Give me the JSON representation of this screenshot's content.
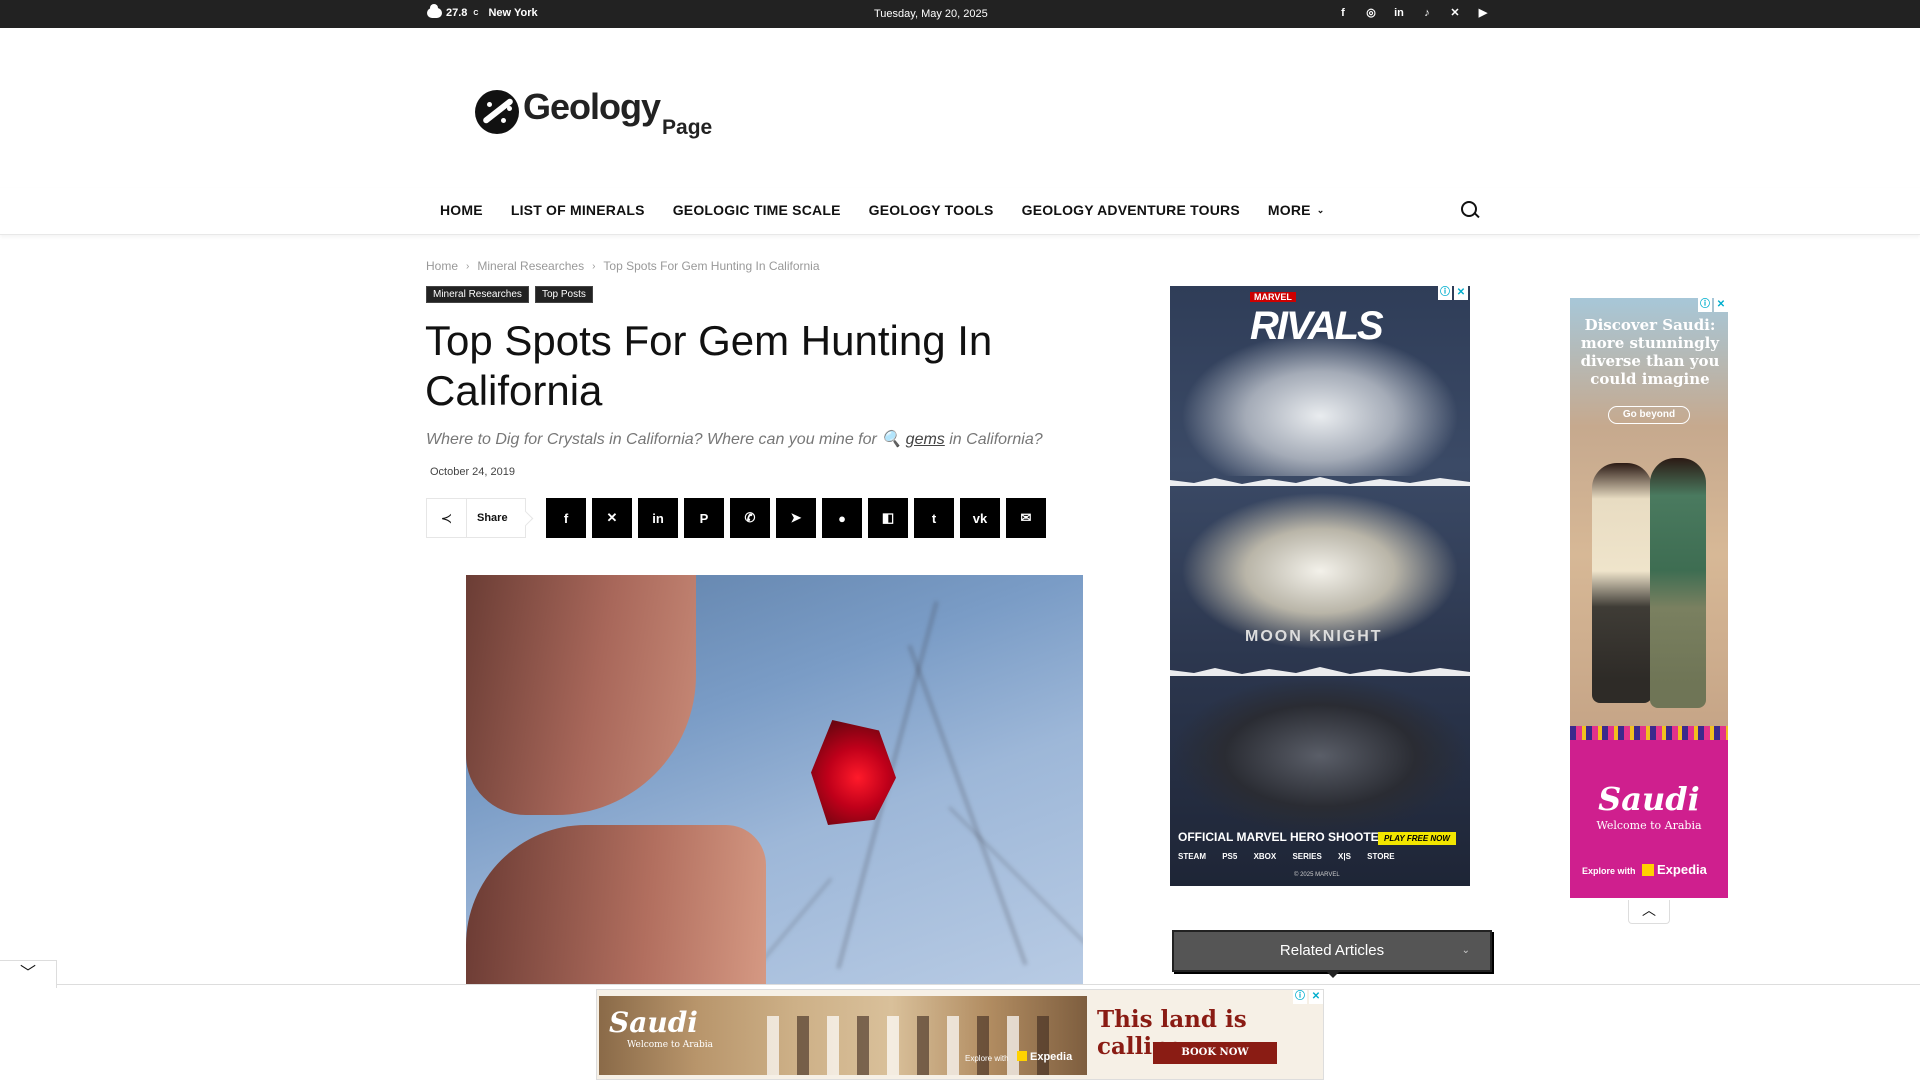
{
  "topbar": {
    "temperature": "27.8",
    "degree_symbol": "C",
    "city": "New York",
    "date": "Tuesday, May 20, 2025",
    "socials": [
      "facebook-icon",
      "instagram-icon",
      "linkedin-icon",
      "tiktok-icon",
      "x-icon",
      "youtube-icon"
    ]
  },
  "logo": {
    "word": "Geology",
    "sub": "Page"
  },
  "nav": {
    "items": [
      "HOME",
      "LIST OF MINERALS",
      "GEOLOGIC TIME SCALE",
      "GEOLOGY TOOLS",
      "GEOLOGY ADVENTURE TOURS",
      "MORE"
    ]
  },
  "breadcrumb": [
    "Home",
    "Mineral Researches",
    "Top Spots For Gem Hunting In California"
  ],
  "categories": [
    "Mineral Researches",
    "Top Posts"
  ],
  "article": {
    "title": "Top Spots For Gem Hunting In California",
    "subtitle_before": "Where to Dig for Crystals in California? Where can you mine for",
    "subtitle_link": "gems",
    "subtitle_after": "in California?",
    "date": "October 24, 2019"
  },
  "share": {
    "label": "Share",
    "buttons": [
      "facebook",
      "x",
      "linkedin",
      "pinterest",
      "whatsapp",
      "telegram",
      "reddit",
      "flipboard",
      "tumblr",
      "vk",
      "email"
    ]
  },
  "ad_rivals": {
    "brand": "MARVEL",
    "title": "RIVALS",
    "moon": "MOON KNIGHT",
    "headline": "OFFICIAL MARVEL HERO SHOOTER",
    "cta": "PLAY FREE NOW",
    "platforms": "STEAM PS5 XBOX SERIES X|S STORE",
    "copyright": "© 2025 MARVEL"
  },
  "ad_saudi_side": {
    "headline": "Discover Saudi: more stunningly diverse than you could imagine",
    "cta": "Go beyond",
    "brand": "Saudi",
    "welcome": "Welcome to Arabia",
    "explore": "Explore with",
    "partner": "Expedia"
  },
  "related": {
    "label": "Related Articles"
  },
  "ad_saudi_bottom": {
    "brand": "Saudi",
    "welcome": "Welcome to Arabia",
    "explore": "Explore with",
    "partner": "Expedia",
    "headline": "This land is calling",
    "cta": "BOOK NOW"
  }
}
